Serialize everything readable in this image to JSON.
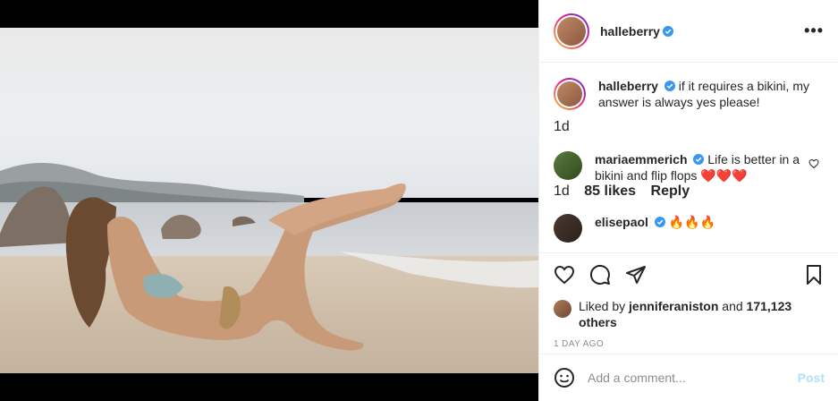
{
  "post": {
    "author": "halleberry",
    "more_icon": "•••"
  },
  "caption": {
    "username": "halleberry",
    "text": "if it requires a bikini, my answer is always yes please!",
    "time": "1d"
  },
  "comments": [
    {
      "username": "mariaemmerich",
      "text": "Life is better in a bikini and flip flops",
      "emoji": "❤️❤️❤️",
      "time": "1d",
      "likes": "85 likes",
      "reply_label": "Reply"
    },
    {
      "username": "elisepaol",
      "emoji": "🔥🔥🔥"
    }
  ],
  "likes": {
    "prefix": "Liked by",
    "user": "jenniferaniston",
    "joiner": "and",
    "others": "171,123 others"
  },
  "posted_ago": "1 DAY AGO",
  "add_comment": {
    "placeholder": "Add a comment...",
    "post_label": "Post"
  },
  "colors": {
    "verified": "#3897f0",
    "post_disabled": "#b2dffc",
    "muted": "#8e8e8e",
    "heart_red": "#ed4956"
  },
  "icons": [
    "verified-badge-icon",
    "more-options-icon",
    "heart-icon",
    "comment-icon",
    "share-icon",
    "bookmark-icon",
    "emoji-icon",
    "small-heart-icon"
  ]
}
